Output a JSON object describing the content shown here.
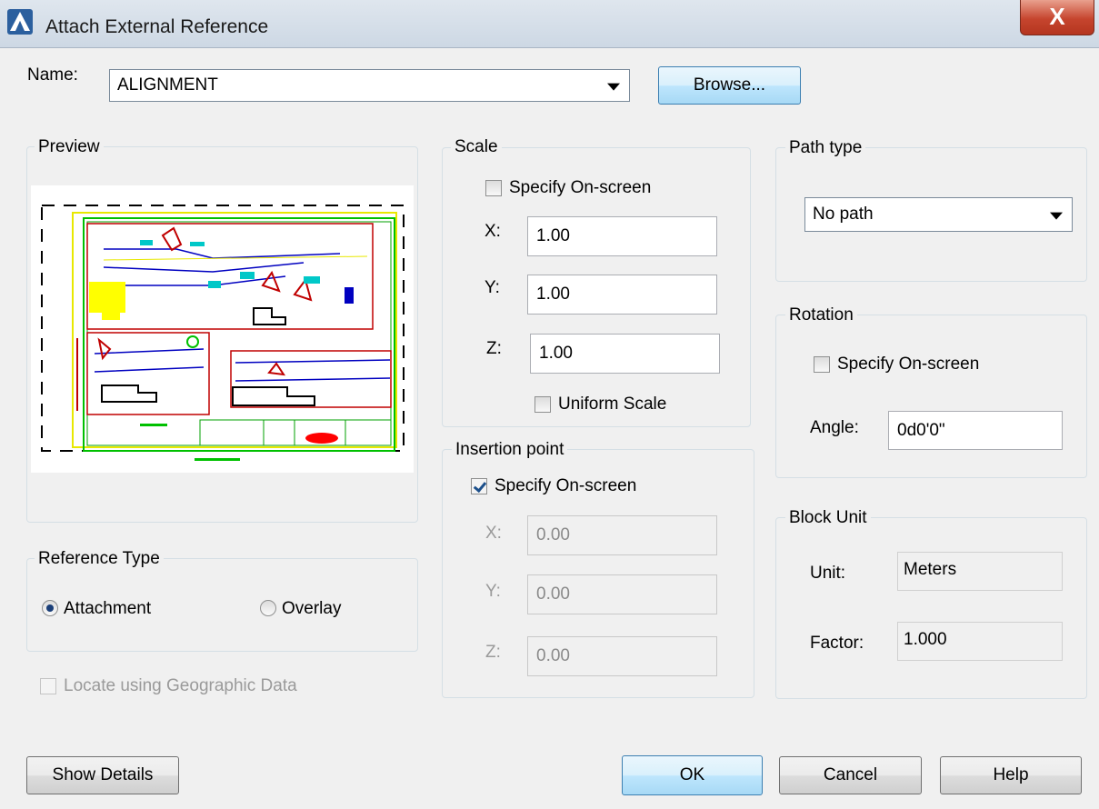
{
  "window": {
    "title": "Attach External Reference",
    "close_label": "X"
  },
  "name_row": {
    "label": "Name:",
    "value": "ALIGNMENT",
    "browse_label": "Browse..."
  },
  "preview": {
    "title": "Preview"
  },
  "reference_type": {
    "title": "Reference Type",
    "attachment_label": "Attachment",
    "overlay_label": "Overlay",
    "selected": "Attachment"
  },
  "geo": {
    "label": "Locate using Geographic Data",
    "checked": false,
    "enabled": false
  },
  "scale": {
    "title": "Scale",
    "specify_label": "Specify On-screen",
    "specify_checked": false,
    "x_label": "X:",
    "x": "1.00",
    "y_label": "Y:",
    "y": "1.00",
    "z_label": "Z:",
    "z": "1.00",
    "uniform_label": "Uniform Scale",
    "uniform_checked": false
  },
  "insertion": {
    "title": "Insertion point",
    "specify_label": "Specify On-screen",
    "specify_checked": true,
    "x_label": "X:",
    "x": "0.00",
    "y_label": "Y:",
    "y": "0.00",
    "z_label": "Z:",
    "z": "0.00"
  },
  "path_type": {
    "title": "Path type",
    "value": "No path"
  },
  "rotation": {
    "title": "Rotation",
    "specify_label": "Specify On-screen",
    "specify_checked": false,
    "angle_label": "Angle:",
    "angle": "0d0'0\""
  },
  "block_unit": {
    "title": "Block Unit",
    "unit_label": "Unit:",
    "unit": "Meters",
    "factor_label": "Factor:",
    "factor": "1.000"
  },
  "buttons": {
    "show_details": "Show Details",
    "ok": "OK",
    "cancel": "Cancel",
    "help": "Help"
  },
  "colors": {
    "accent_border": "#3c7fb1",
    "close": "#c6452e",
    "drawing_red": "#c00000",
    "drawing_blue": "#0000c0",
    "drawing_green": "#00c000",
    "drawing_yellow": "#ffff00",
    "drawing_cyan": "#00c8c8"
  }
}
